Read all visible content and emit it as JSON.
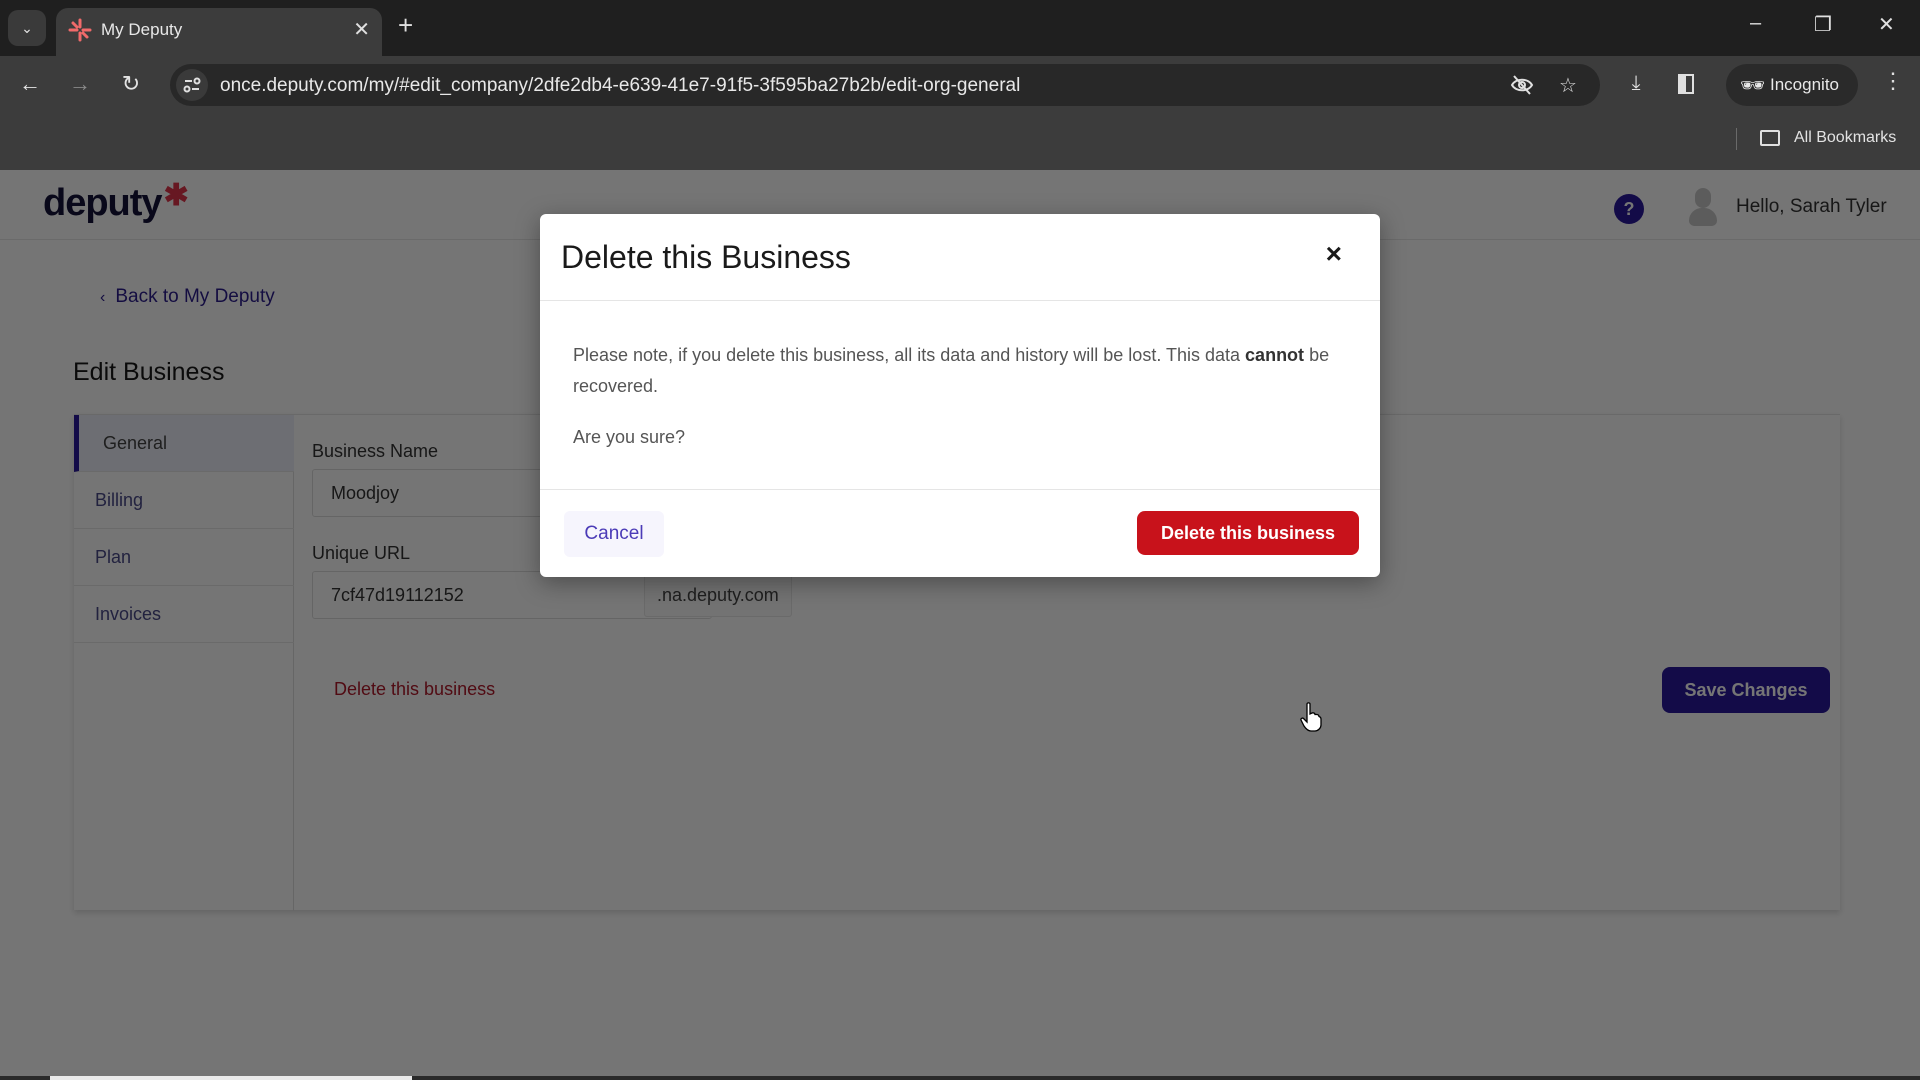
{
  "browser": {
    "tab_title": "My Deputy",
    "url": "once.deputy.com/my/#edit_company/2dfe2db4-e639-41e7-91f5-3f595ba27b2b/edit-org-general",
    "incognito_label": "Incognito",
    "bookmarks_label": "All Bookmarks"
  },
  "header": {
    "logo_text": "deputy",
    "help_label": "?",
    "greeting": "Hello, Sarah Tyler"
  },
  "page": {
    "back_link": "Back to My Deputy",
    "title": "Edit Business",
    "sidebar": [
      {
        "label": "General",
        "active": true
      },
      {
        "label": "Billing",
        "active": false
      },
      {
        "label": "Plan",
        "active": false
      },
      {
        "label": "Invoices",
        "active": false
      }
    ],
    "form": {
      "business_name_label": "Business Name",
      "business_name_value": "Moodjoy",
      "unique_url_label": "Unique URL",
      "unique_url_value": "7cf47d19112152",
      "unique_url_suffix": ".na.deputy.com"
    },
    "delete_link": "Delete this business",
    "save_button": "Save Changes"
  },
  "modal": {
    "title": "Delete this Business",
    "close_label": "×",
    "body_before": "Please note, if you delete this business, all its data and history will be lost. This data ",
    "body_bold": "cannot",
    "body_after": " be recovered.",
    "question": "Are you sure?",
    "cancel_button": "Cancel",
    "confirm_button": "Delete this business"
  },
  "colors": {
    "brand_primary": "#2b1a9e",
    "danger": "#c8121b",
    "logo_accent": "#e0364a"
  }
}
